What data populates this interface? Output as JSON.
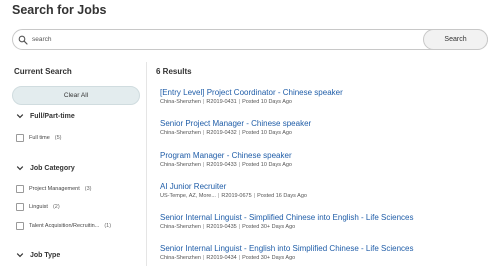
{
  "header": {
    "title": "Search for Jobs"
  },
  "search": {
    "placeholder": "search",
    "value": "",
    "button_label": "Search"
  },
  "sidebar": {
    "title": "Current Search",
    "clear_label": "Clear All",
    "facets": [
      {
        "title": "Full/Part-time",
        "options": [
          {
            "label": "Full time",
            "count": "(5)"
          }
        ]
      },
      {
        "title": "Job Category",
        "options": [
          {
            "label": "Project Management",
            "count": "(3)"
          },
          {
            "label": "Linguist",
            "count": "(2)"
          },
          {
            "label": "Talent Acquisition/Recruitin...",
            "count": "(1)"
          }
        ]
      },
      {
        "title": "Job Type",
        "options": []
      }
    ]
  },
  "results": {
    "count_label": "6 Results",
    "jobs": [
      {
        "title": "[Entry Level] Project Coordinator - Chinese speaker",
        "location": "China-Shenzhen",
        "req_id": "R2019-0431",
        "posted": "Posted 10 Days Ago"
      },
      {
        "title": "Senior Project Manager - Chinese speaker",
        "location": "China-Shenzhen",
        "req_id": "R2019-0432",
        "posted": "Posted 10 Days Ago"
      },
      {
        "title": "Program Manager - Chinese speaker",
        "location": "China-Shenzhen",
        "req_id": "R2019-0433",
        "posted": "Posted 10 Days Ago"
      },
      {
        "title": "AI Junior Recruiter",
        "location": "US-Tempe, AZ, More...",
        "req_id": "R2019-0675",
        "posted": "Posted 16 Days Ago"
      },
      {
        "title": "Senior Internal Linguist - Simplified Chinese into English - Life Sciences",
        "location": "China-Shenzhen",
        "req_id": "R2019-0435",
        "posted": "Posted 30+ Days Ago"
      },
      {
        "title": "Senior Internal Linguist - English into Simplified Chinese - Life Sciences",
        "location": "China-Shenzhen",
        "req_id": "R2019-0434",
        "posted": "Posted 30+ Days Ago"
      }
    ]
  },
  "icons": {
    "search": "search-icon",
    "chevron": "chevron-down-icon"
  },
  "colors": {
    "link": "#1f5da8",
    "clear_button_bg": "#e3ecee",
    "search_button_bg": "#f2f2f2"
  }
}
